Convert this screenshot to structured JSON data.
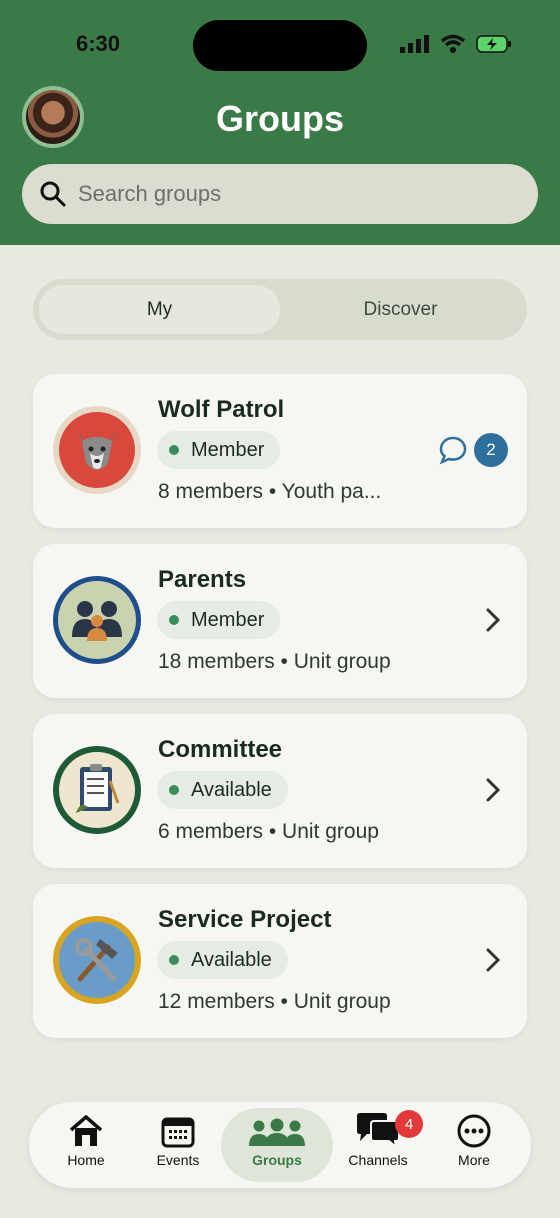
{
  "status_bar": {
    "time": "6:30"
  },
  "header": {
    "title": "Groups"
  },
  "search": {
    "placeholder": "Search groups"
  },
  "segments": [
    {
      "label": "My",
      "active": true
    },
    {
      "label": "Discover",
      "active": false
    }
  ],
  "groups": [
    {
      "name": "Wolf Patrol",
      "status": "Member",
      "meta": "8 members • Youth pa...",
      "icon": "wolf-icon",
      "unread": "2"
    },
    {
      "name": "Parents",
      "status": "Member",
      "meta": "18 members • Unit group",
      "icon": "parents-icon"
    },
    {
      "name": "Committee",
      "status": "Available",
      "meta": "6 members • Unit group",
      "icon": "clipboard-icon"
    },
    {
      "name": "Service Project",
      "status": "Available",
      "meta": "12 members • Unit group",
      "icon": "tools-icon"
    }
  ],
  "tabs": [
    {
      "label": "Home",
      "icon": "home-icon"
    },
    {
      "label": "Events",
      "icon": "calendar-icon"
    },
    {
      "label": "Groups",
      "icon": "groups-icon",
      "active": true
    },
    {
      "label": "Channels",
      "icon": "chat-bubbles-icon",
      "badge": "4"
    },
    {
      "label": "More",
      "icon": "more-icon"
    }
  ],
  "colors": {
    "header": "#3a7a47",
    "accent_blue": "#2f6f9e",
    "status_green": "#3b8c5c",
    "badge_red": "#e23a3a"
  }
}
